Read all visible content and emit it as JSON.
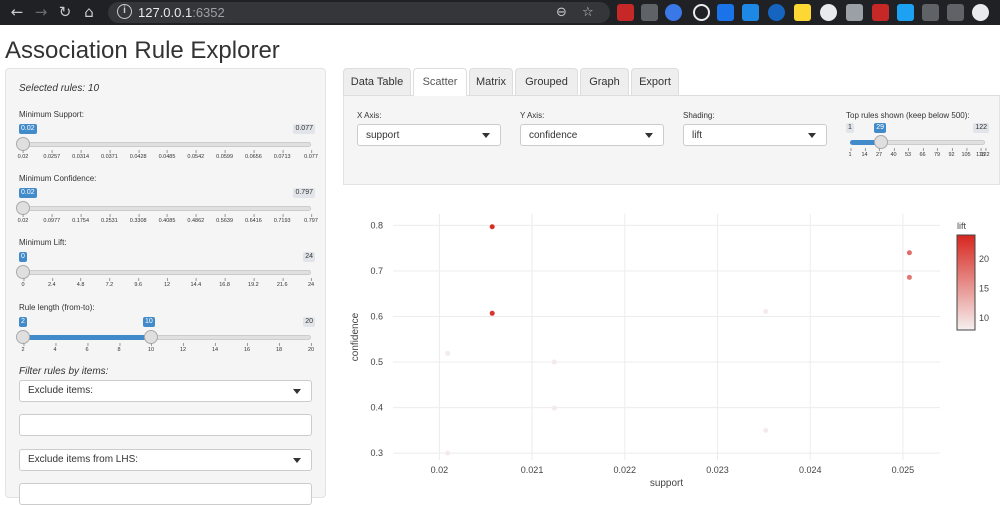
{
  "browser": {
    "url_host": "127.0.0.1",
    "url_port": ":6352"
  },
  "app": {
    "title": "Association Rule Explorer"
  },
  "sidebar": {
    "selected_rules": "Selected rules: 10",
    "sliders": [
      {
        "label": "Minimum Support:",
        "value": "0.02",
        "max": "0.077",
        "value_fraction": 0,
        "ticks": [
          "0.02",
          "0.0257",
          "0.0314",
          "0.0371",
          "0.0428",
          "0.0485",
          "0.0542",
          "0.0599",
          "0.0656",
          "0.0713",
          "0.077"
        ]
      },
      {
        "label": "Minimum Confidence:",
        "value": "0.02",
        "max": "0.797",
        "value_fraction": 0,
        "ticks": [
          "0.02",
          "0.0977",
          "0.1754",
          "0.2531",
          "0.3308",
          "0.4085",
          "0.4862",
          "0.5639",
          "0.6416",
          "0.7193",
          "0.797"
        ]
      },
      {
        "label": "Minimum Lift:",
        "value": "0",
        "max": "24",
        "value_fraction": 0,
        "ticks": [
          "0",
          "2.4",
          "4.8",
          "7.2",
          "9.6",
          "12",
          "14.4",
          "16.8",
          "19.2",
          "21.6",
          "24"
        ]
      },
      {
        "label": "Rule length (from-to):",
        "value": "2",
        "value_to": "10",
        "max": "20",
        "value_fraction": 0,
        "value_to_fraction": 0.4444,
        "ticks": [
          "2",
          "4",
          "6",
          "8",
          "10",
          "12",
          "14",
          "16",
          "18",
          "20"
        ]
      }
    ],
    "filter_heading": "Filter rules by items:",
    "exclude_items": "Exclude items:",
    "exclude_lhs": "Exclude items from LHS:"
  },
  "tabs": [
    "Data Table",
    "Scatter",
    "Matrix",
    "Grouped",
    "Graph",
    "Export"
  ],
  "active_tab": "Scatter",
  "controls": {
    "x_axis_label": "X Axis:",
    "x_axis_value": "support",
    "y_axis_label": "Y Axis:",
    "y_axis_value": "confidence",
    "shading_label": "Shading:",
    "shading_value": "lift",
    "top_rules_label": "Top rules shown (keep below 500):",
    "top_rules_min": "1",
    "top_rules_value": "29",
    "top_rules_max": "122",
    "top_rules_ticks": [
      "1",
      "14",
      "27",
      "40",
      "53",
      "66",
      "79",
      "92",
      "105",
      "118",
      "122"
    ]
  },
  "chart_data": {
    "type": "scatter",
    "xlabel": "support",
    "ylabel": "confidence",
    "xlim": [
      0.0195,
      0.0254
    ],
    "ylim": [
      0.285,
      0.825
    ],
    "x_ticks": [
      "0.02",
      "0.021",
      "0.022",
      "0.023",
      "0.024",
      "0.025"
    ],
    "y_ticks": [
      "0.3",
      "0.4",
      "0.5",
      "0.6",
      "0.7",
      "0.8"
    ],
    "legend_title": "lift",
    "color_scale": {
      "min": 8,
      "max": 24,
      "low_color": "#f5f0f0",
      "high_color": "#d7261e"
    },
    "colorbar_ticks": [
      "10",
      "15",
      "20"
    ],
    "points": [
      {
        "x": 0.02057,
        "y": 0.797,
        "lift": 23.5
      },
      {
        "x": 0.02057,
        "y": 0.607,
        "lift": 23.0
      },
      {
        "x": 0.02507,
        "y": 0.74,
        "lift": 18.5
      },
      {
        "x": 0.02507,
        "y": 0.686,
        "lift": 17.5
      },
      {
        "x": 0.02009,
        "y": 0.519,
        "lift": 8.5
      },
      {
        "x": 0.02009,
        "y": 0.3,
        "lift": 8.5
      },
      {
        "x": 0.02124,
        "y": 0.5,
        "lift": 8.5
      },
      {
        "x": 0.02124,
        "y": 0.399,
        "lift": 8.5
      },
      {
        "x": 0.02352,
        "y": 0.611,
        "lift": 8.5
      },
      {
        "x": 0.02352,
        "y": 0.35,
        "lift": 8.5
      }
    ]
  }
}
